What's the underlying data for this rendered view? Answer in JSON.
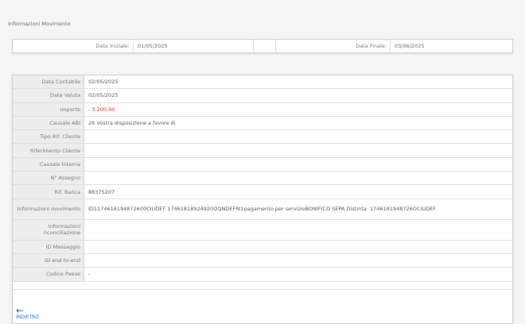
{
  "title": "Informazioni Movimento",
  "date_filter": {
    "start_label": "Data Iniziale:",
    "start_value": "01/05/2025",
    "end_label": "Data Finale:",
    "end_value": "03/06/2025"
  },
  "details": [
    {
      "label": "Data Contabile",
      "value": "02/05/2025"
    },
    {
      "label": "Data Valuta",
      "value": "02/05/2025"
    },
    {
      "label": "Importo",
      "value": "- 3.200,00"
    },
    {
      "label": "Causale ABI",
      "value": "26 Vostra disposizione a favore di"
    },
    {
      "label": "Tipo Rif. Cliente",
      "value": ""
    },
    {
      "label": "Riferimento Cliente",
      "value": ""
    },
    {
      "label": "Causale Interna",
      "value": ""
    },
    {
      "label": "N° Assegno",
      "value": ""
    },
    {
      "label": "Rif. Banca",
      "value": "88375207"
    },
    {
      "label": "Informazioni movimento",
      "value": "ID1174618194872600CIUDEF 17461818924920OQNDEFRI1pagamento per servizioBONIFICO SEPA Distinta: 1746181948726OCIUDEF"
    },
    {
      "label": "Informazioni riconciliazione",
      "value": ""
    },
    {
      "label": "ID Messaggio",
      "value": ""
    },
    {
      "label": "ID end-to-end",
      "value": ""
    },
    {
      "label": "Codice Paese",
      "value": "-"
    }
  ],
  "back_label": "INDIETRO",
  "colors": {
    "amount_negative": "#d0253a",
    "link": "#2a6bb0"
  }
}
